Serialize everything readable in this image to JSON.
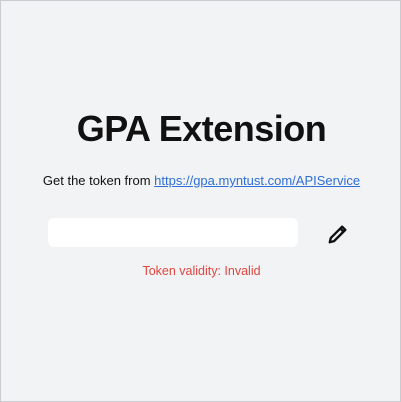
{
  "app": {
    "title": "GPA Extension"
  },
  "instructions": {
    "prefix": "Get the token from ",
    "link_text": "https://gpa.myntust.com/APIService"
  },
  "token_input": {
    "value": "",
    "placeholder": ""
  },
  "edit_button": {
    "icon": "pencil-icon"
  },
  "status": {
    "text": "Token validity: Invalid",
    "color": "#e0453f"
  },
  "colors": {
    "background": "#f2f3f5",
    "link": "#2f6fd6",
    "error": "#e0453f"
  }
}
